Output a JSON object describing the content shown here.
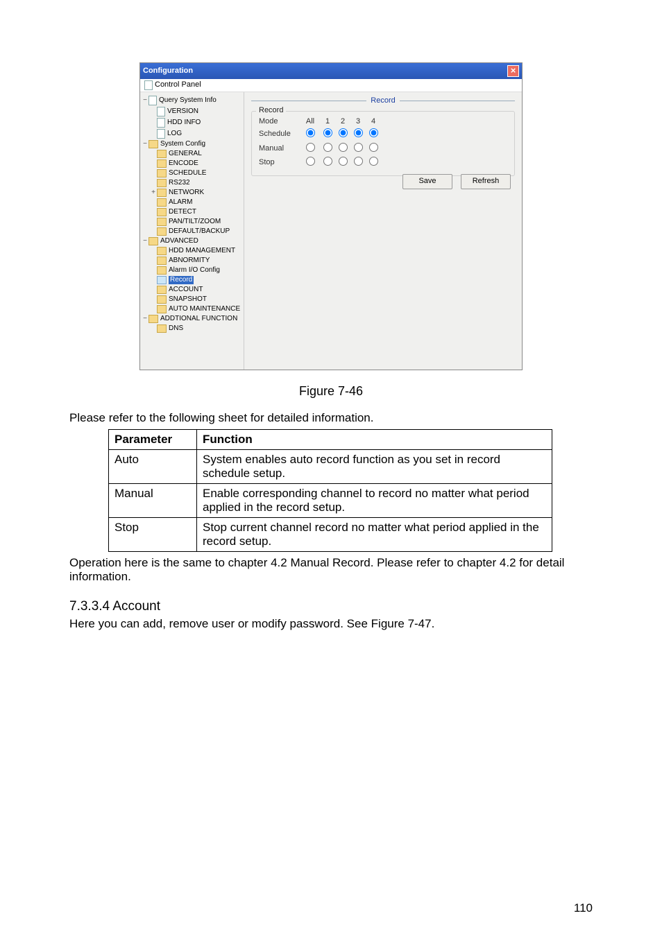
{
  "win": {
    "title": "Configuration",
    "control_panel": "Control Panel",
    "tree": {
      "root1": "Query System Info",
      "version": "VERSION",
      "hddinfo": "HDD INFO",
      "log": "LOG",
      "root2": "System Config",
      "general": "GENERAL",
      "encode": "ENCODE",
      "schedule": "SCHEDULE",
      "rs232": "RS232",
      "network": "NETWORK",
      "alarm": "ALARM",
      "detect": "DETECT",
      "ptz": "PAN/TILT/ZOOM",
      "defback": "DEFAULT/BACKUP",
      "root3": "ADVANCED",
      "hddmgmt": "HDD MANAGEMENT",
      "abnorm": "ABNORMITY",
      "alarmio": "Alarm I/O Config",
      "record": "Record",
      "account": "ACCOUNT",
      "snapshot": "SNAPSHOT",
      "automaint": "AUTO MAINTENANCE",
      "root4": "ADDTIONAL FUNCTION",
      "dns": "DNS"
    },
    "section": "Record",
    "rec_legend": "Record",
    "mode": "Mode",
    "all": "All",
    "c1": "1",
    "c2": "2",
    "c3": "3",
    "c4": "4",
    "row_schedule": "Schedule",
    "row_manual": "Manual",
    "row_stop": "Stop",
    "save": "Save",
    "refresh": "Refresh"
  },
  "caption": "Figure 7-46",
  "intro": "Please refer to the following sheet for detailed information.",
  "tbl": {
    "h1": "Parameter",
    "h2": "Function",
    "r1a": "Auto",
    "r1b": "System enables auto record function as you set in record schedule setup.",
    "r2a": "Manual",
    "r2b": "Enable corresponding channel to record no matter what period applied in the record setup.",
    "r3a": "Stop",
    "r3b": "Stop current channel record no matter what period applied in the record setup."
  },
  "para2": "Operation here is the same to chapter 4.2 Manual Record. Please refer to chapter 4.2 for detail information.",
  "heading": "7.3.3.4  Account",
  "para3": "Here you can add, remove user or modify password. See Figure 7-47.",
  "pagenum": "110"
}
